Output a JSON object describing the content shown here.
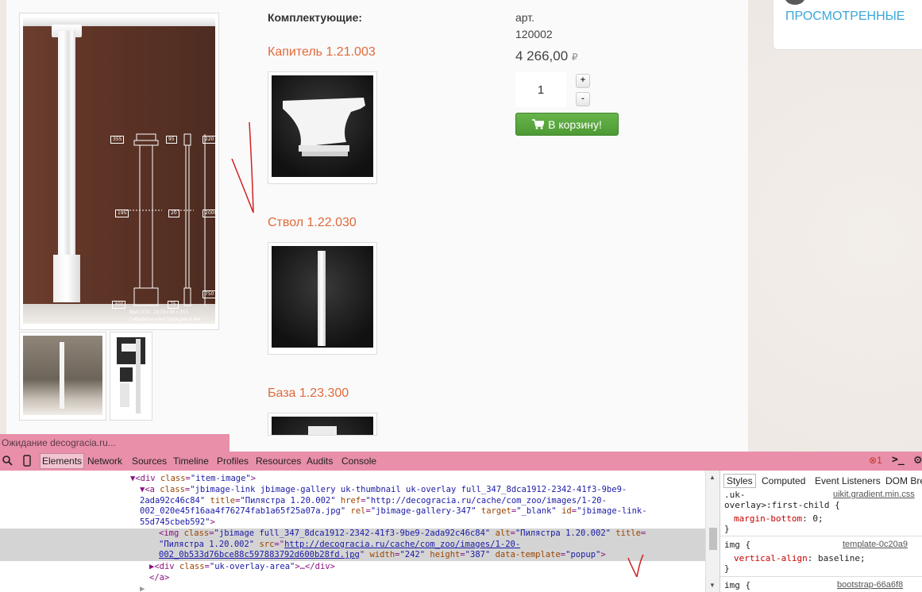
{
  "product": {
    "section_heading": "Комплектующие:",
    "sku_label": "арт.",
    "sku_value": "120002",
    "price": "4 266,00",
    "currency": "₽",
    "quantity": "1",
    "qty_plus": "+",
    "qty_minus": "-",
    "cart_button": "В корзину!",
    "drawing": {
      "dims": [
        "355",
        "95",
        "220",
        "195",
        "20",
        "2000",
        "300",
        "75",
        "750"
      ],
      "caption_1": "ВЫСОТА",
      "caption_2": "2970×95×355",
      "caption_3": "габариты конструкции в мм"
    }
  },
  "components": [
    {
      "title": "Капитель 1.21.003"
    },
    {
      "title": "Ствол 1.22.030"
    },
    {
      "title": "База 1.23.300"
    }
  ],
  "sidebar": {
    "viewed_label": "ПРОСМОТРЕННЫЕ"
  },
  "browser": {
    "status": "Ожидание decogracia.ru..."
  },
  "devtools": {
    "tabs": [
      "Elements",
      "Network",
      "Sources",
      "Timeline",
      "Profiles",
      "Resources",
      "Audits",
      "Console"
    ],
    "error_count": "1",
    "styles_tabs": [
      "Styles",
      "Computed",
      "Event Listeners",
      "DOM Bre"
    ],
    "code": {
      "l1_tag": "<div ",
      "l1_attr": "class",
      "l1_val": "\"item-image\"",
      "l1_end": ">",
      "l2_a": "<a ",
      "l2_class_attr": "class",
      "l2_class_val": "\"jbimage-link jbimage-gallery uk-thumbnail uk-overlay full_347_8dca1912-2342-41f3-9be9-",
      "l3": "2ada92c46c84\"",
      "l3_title_attr": "title",
      "l3_title_val": "\"Пилястра 1.20.002\"",
      "l3_href_attr": "href",
      "l3_href_val": "\"http://decogracia.ru/cache/com_zoo/images/1-20-",
      "l4_val": "002_020e45f16aa4f76274fab1a65f25a07a.jpg\"",
      "l4_rel_attr": "rel",
      "l4_rel_val": "\"jbimage-gallery-347\"",
      "l4_target_attr": "target",
      "l4_target_val": "\"_blank\"",
      "l4_id_attr": "id",
      "l4_id_val": "\"jbimage-link-",
      "l5_val": "55d745cbeb592\"",
      "l6_img": "<img ",
      "l6_class_attr": "class",
      "l6_class_val": "\"jbimage full_347_8dca1912-2342-41f3-9be9-2ada92c46c84\"",
      "l6_alt_attr": "alt",
      "l6_alt_val": "\"Пилястра 1.20.002\"",
      "l6_title_attr": "title",
      "l7_title_val": "\"Пилястра 1.20.002\"",
      "l7_src_attr": "src",
      "l7_src_link": "http://decogracia.ru/cache/com_zoo/images/1-20-",
      "l8_link": "002_0b533d76bce88c597883792d600b28fd.jpg",
      "l8_width_attr": "width",
      "l8_width_val": "\"242\"",
      "l8_height_attr": "height",
      "l8_height_val": "\"387\"",
      "l8_dt_attr": "data-template",
      "l8_dt_val": "\"popup\"",
      "l9_tag": "<div ",
      "l9_attr": "class",
      "l9_val": "\"uk-overlay-area\"",
      "l9_end": ">…</div>",
      "l10": "</a>"
    },
    "styles": {
      "r1_selector_1": ".uk-",
      "r1_selector_2": "overlay>:first-child {",
      "r1_source": "uikit.gradient.min.css",
      "r1_prop": "margin-bottom",
      "r1_val": ": 0;",
      "r2_selector": "img {",
      "r2_source": "template-0c20a9",
      "r2_prop": "vertical-align",
      "r2_val": ": baseline;",
      "r3_selector": "img {",
      "r3_source": "bootstrap-66a6f8",
      "close": "}"
    }
  }
}
